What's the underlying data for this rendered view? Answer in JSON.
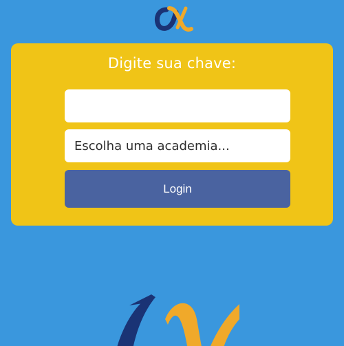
{
  "brand": {
    "logo_icon": "alpha-logo-icon",
    "navy": "#1a3375",
    "orange": "#f0a92a"
  },
  "colors": {
    "page_background": "#3a97dd",
    "card": "#f0c417",
    "button": "#4a63a0"
  },
  "login_form": {
    "title": "Digite sua chave:",
    "key_input": {
      "value": "",
      "placeholder": ""
    },
    "gym_select": {
      "selected": "Escolha uma academia..."
    },
    "login_button_label": "Login"
  }
}
